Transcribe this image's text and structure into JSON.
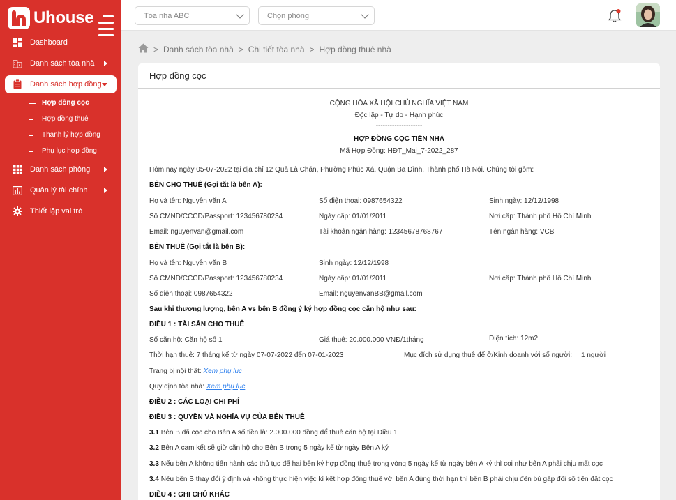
{
  "brand": {
    "name": "Uhouse"
  },
  "sidebar": {
    "items": [
      {
        "label": "Dashboard",
        "icon": "dashboard-icon"
      },
      {
        "label": "Danh sách tòa nhà",
        "icon": "building-icon"
      },
      {
        "label": "Danh sách hợp đồng",
        "icon": "clipboard-icon"
      },
      {
        "label": "Danh sách phòng",
        "icon": "grid-icon"
      },
      {
        "label": "Quản lý tài chính",
        "icon": "chart-icon"
      },
      {
        "label": "Thiết lập vai trò",
        "icon": "gear-icon"
      }
    ],
    "subitems": [
      "Hợp đồng cọc",
      "Hợp đồng thuê",
      "Thanh lý hợp đồng",
      "Phụ lục hợp đồng"
    ]
  },
  "topbar": {
    "building_placeholder": "Tòa nhà ABC",
    "room_placeholder": "Chọn phòng"
  },
  "breadcrumb": [
    "Danh sách tòa nhà",
    "Chi tiết tòa nhà",
    "Hợp đồng thuê nhà"
  ],
  "card": {
    "title": "Hợp đồng cọc"
  },
  "doc": {
    "country": "CỘNG HÒA XÃ HỘI CHỦ NGHĨA VIỆT NAM",
    "motto": "Độc lập - Tự do - Hạnh phúc",
    "divider": "--------------------",
    "title": "HỢP ĐỒNG CỌC TIỀN NHÀ",
    "code": "Mã Hợp Đồng: HĐT_Mai_7-2022_287",
    "intro": "Hôm nay ngày 05-07-2022 tại địa chỉ 12 Quả Là Chán, Phường Phúc Xá, Quận Ba Đình, Thành phố Hà Nội. Chúng tôi gồm:",
    "partyA": {
      "heading": "BÊN CHO THUÊ (Gọi tắt là bên A):",
      "name": "Họ và tên:  Nguyễn văn A",
      "phone": "Số điện thoại:  0987654322",
      "dob": "Sinh ngày:  12/12/1998",
      "id": "Số CMND/CCCD/Passport:     123456780234",
      "issue_date": "Ngày cấp:  01/01/2011",
      "issue_place": "Nơi cấp:  Thành phố Hồ Chí Minh",
      "email": "Email:  nguyenvan@gmail.com",
      "bank_account": "Tài khoản ngân hàng:  12345678768767",
      "bank_name": "Tên ngân hàng:  VCB"
    },
    "partyB": {
      "heading": "BÊN THUÊ (Gọi tắt là bên B):",
      "name": "Họ và tên:  Nguyễn văn B",
      "dob": "Sinh ngày:  12/12/1998",
      "id": "Số CMND/CCCD/Passport:     123456780234",
      "issue_date": "Ngày cấp:  01/01/2011",
      "issue_place": "Nơi cấp:  Thành phố Hồ Chí Minh",
      "phone": "Số điện thoại:  0987654322",
      "email": "Email:  nguyenvanBB@gmail.com"
    },
    "agreement": "Sau khi thương lượng, bên A vs bên B đồng ý ký hợp đồng cọc căn hộ như sau:",
    "art1": {
      "heading": "ĐIỀU 1 : TÀI SẢN CHO THUÊ",
      "unit": "Số căn hộ:  Căn hộ số 1",
      "price": "Giá thuê:  20.000.000 VNĐ/1tháng",
      "area": "Diện tích:   12m2",
      "term": "Thời hạn thuê:        7 tháng kể từ ngày 07-07-2022 đến 07-01-2023",
      "purpose": "Mục đích sử dụng thuê để ở/Kinh doanh với số người:",
      "people": "1 người",
      "furniture_label": "Trang bị nội thất:",
      "furniture_link": "Xem phụ lục",
      "rules_label": "Quy định tòa nhà:",
      "rules_link": "Xem phụ lục"
    },
    "art2": "ĐIỀU 2 : CÁC LOẠI CHI PHÍ",
    "art3": {
      "heading": "ĐIỀU 3 : QUYỀN VÀ NGHĨA VỤ CỦA BÊN THUÊ",
      "items": [
        {
          "num": "3.1",
          "text": "Bên B đã cọc cho Bên A số tiền là: 2.000.000 đồng để thuê căn hộ tại Điều 1"
        },
        {
          "num": "3.2",
          "text": "Bên A cam kết sẽ giữ căn hộ cho Bên B trong 5 ngày kể từ ngày Bên A ký"
        },
        {
          "num": "3.3",
          "text": "Nếu bên A không tiến hành các thủ tục để hai bên ký hợp đồng thuê trong vòng 5 ngày kể từ ngày bên A ký thì coi như bên A phải chịu mất cọc"
        },
        {
          "num": "3.4",
          "text": "Nếu bên B thay đổi ý định và không thực hiện việc kí kết hợp đồng thuê với bên A đúng thời hạn thì bên B phải chịu đền bù gấp đôi số tiền đặt cọc"
        }
      ]
    },
    "art4": "ĐIỀU 4 : GHI CHÚ KHÁC"
  }
}
